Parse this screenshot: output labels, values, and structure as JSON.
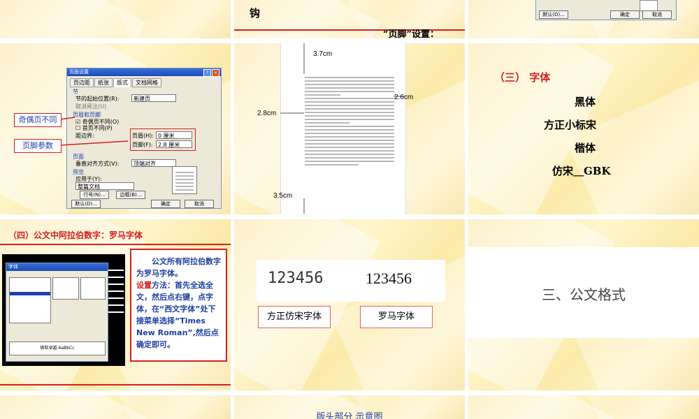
{
  "slide1": {
    "word": "钩"
  },
  "slide2": {
    "footer_setting": "“页脚”设置："
  },
  "slide3": {
    "ok": "确定",
    "cancel": "取消",
    "default": "默认(D)..."
  },
  "slide4": {
    "dialog_title": "页面设置",
    "tabs": [
      "页边距",
      "纸张",
      "版式",
      "文档网格"
    ],
    "section_label": "节",
    "section_start_label": "节的起始位置(R):",
    "section_start_value": "新建页",
    "cancel_endnote": "取消尾注(U)",
    "header_footer_label": "页眉和页脚",
    "odd_even": "奇偶页不同(O)",
    "first_page": "首页不同(P)",
    "from_edge": "距边界:",
    "header_label": "页眉(H):",
    "header_value": "0 厘米",
    "footer_label": "页脚(F):",
    "footer_value": "2.8 厘米",
    "page_label": "页面",
    "valign_label": "垂直对齐方式(V):",
    "valign_value": "顶端对齐",
    "preview_label": "预览",
    "apply_label": "应用于(Y):",
    "apply_value": "整篇文档",
    "line_num": "行号(N)...",
    "border": "边框(B)...",
    "default": "默认(D)...",
    "ok": "确定",
    "cancel": "取消",
    "callout_odd_even": "奇偶页不同",
    "callout_footer": "页脚参数"
  },
  "slide5": {
    "top_margin": "3.7cm",
    "right_margin": "2.6cm",
    "left_margin": "2.8cm",
    "bottom_margin": "3.5cm"
  },
  "slide6": {
    "heading": "（三）  字体",
    "fonts": [
      "黑体",
      "方正小标宋",
      "楷体",
      "仿宋＿GBK"
    ]
  },
  "slide7": {
    "title": "（四）公文中阿拉伯数字：罗马字体",
    "desc_p1": "公文所有阿拉伯数字为罗马字体。",
    "desc_p2_label": "设置",
    "desc_p2": "方法：首先全选全文，然后点右键，点字体，在“西文字体”处下接菜单选择“Times New Roman”,然后点确定即可。",
    "dialog_title": "字体",
    "preview_text": "微软卓越 AaBbCc"
  },
  "slide8": {
    "num_fangzheng": "123456",
    "num_roman": "123456",
    "label_fangzheng": "方正仿宋字体",
    "label_roman": "罗马字体"
  },
  "slide9": {
    "title": "三、公文格式"
  },
  "slide11": {
    "title": "版头部分 示意图"
  }
}
